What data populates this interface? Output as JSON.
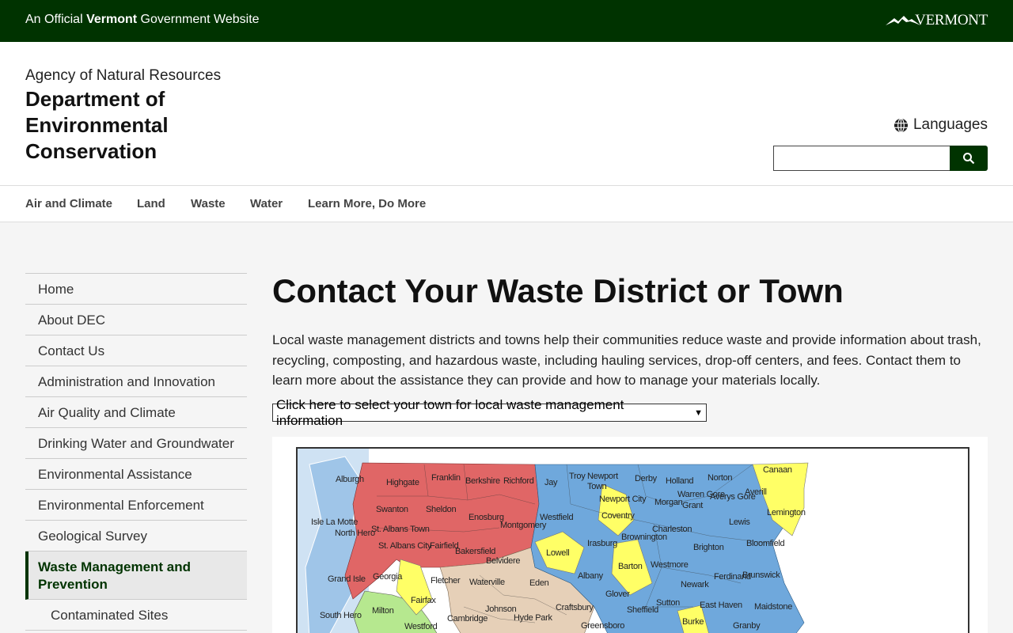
{
  "topbar": {
    "official_prefix": "An Official ",
    "official_state": "Vermont",
    "official_suffix": " Government Website",
    "logo_text": "VERMONT"
  },
  "header": {
    "agency": "Agency of Natural Resources",
    "department": "Department of Environmental Conservation",
    "languages_label": "Languages",
    "search_placeholder": ""
  },
  "nav": {
    "items": [
      "Air and Climate",
      "Land",
      "Waste",
      "Water",
      "Learn More, Do More"
    ]
  },
  "sidebar": {
    "items": [
      "Home",
      "About DEC",
      "Contact Us",
      "Administration and Innovation",
      "Air Quality and Climate",
      "Drinking Water and Groundwater",
      "Environmental Assistance",
      "Environmental Enforcement",
      "Geological Survey",
      "Waste Management and Prevention",
      "Contaminated Sites"
    ]
  },
  "main": {
    "title": "Contact Your Waste District or Town",
    "intro": "Local waste management districts and towns help their communities reduce waste and provide information about trash, recycling, composting, and hazardous waste, including hauling services, drop-off centers, and fees. Contact them to learn more about the assistance they can provide and how to manage your materials locally.",
    "select_value": "Click here to select your town for local waste management information"
  },
  "map": {
    "towns": [
      "Alburgh",
      "Highgate",
      "Franklin",
      "Berkshire",
      "Richford",
      "Jay",
      "Troy",
      "Newport Town",
      "Derby",
      "Holland",
      "Norton",
      "Canaan",
      "Swanton",
      "Sheldon",
      "Newport City",
      "Morgan",
      "Warren Gore",
      "Averys Gore",
      "Averill",
      "Lemington",
      "Isle La Motte",
      "North Hero",
      "St. Albans Town",
      "Enosburg",
      "Montgomery",
      "Westfield",
      "Coventry",
      "Grant",
      "Charleston",
      "Lewis",
      "St. Albans City",
      "Fairfield",
      "Bakersfield",
      "Lowell",
      "Irasburg",
      "Brownington",
      "Brighton",
      "Bloomfield",
      "Belvidere",
      "Westmore",
      "Grand Isle",
      "Georgia",
      "Fletcher",
      "Waterville",
      "Eden",
      "Albany",
      "Barton",
      "Ferdinand",
      "Brunswick",
      "Fairfax",
      "Newark",
      "Glover",
      "Sheffield",
      "Sutton",
      "East Haven",
      "Maidstone",
      "Milton",
      "Johnson",
      "Craftsbury",
      "South Hero",
      "Cambridge",
      "Hyde Park",
      "Burke",
      "Westford",
      "Greensboro",
      "Granby"
    ],
    "district_colors": {
      "northwest": "#e06666",
      "northeast": "#6fa8dc",
      "town": "#ffff66",
      "lamoille": "#e6d0b8",
      "chittenden": "#b6e88f",
      "islands": "#9fc5e8"
    }
  }
}
